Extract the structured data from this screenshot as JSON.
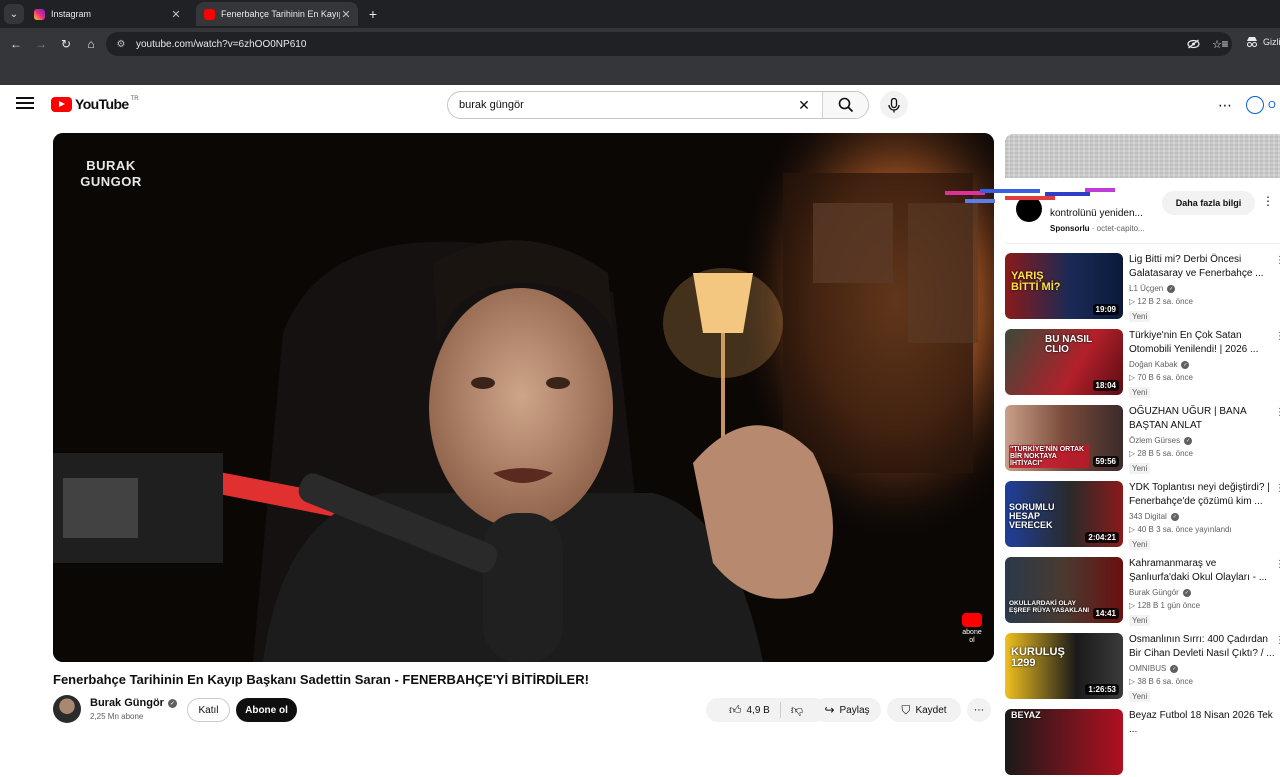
{
  "browser": {
    "tabs": [
      {
        "title": "Instagram",
        "active": false
      },
      {
        "title": "Fenerbahçe Tarihinin En Kayıp B",
        "active": true
      }
    ],
    "url": "youtube.com/watch?v=6zhOO0NP610",
    "profile_label": "Gizli"
  },
  "youtube": {
    "logo_text": "YouTube",
    "logo_country": "TR",
    "search_query": "burak güngör",
    "signin_label": "O"
  },
  "player": {
    "watermark": "BURAK GUNGOR",
    "subscribe_badge": "abone ol"
  },
  "video": {
    "title": "Fenerbahçe Tarihinin En Kayıp Başkanı Sadettin Saran - FENERBAHÇE'Yİ BİTİRDİLER!",
    "channel_name": "Burak Güngör",
    "subscribers": "2,25 Mn abone",
    "join_label": "Katıl",
    "subscribe_label": "Abone ol",
    "likes": "4,9 B",
    "share_label": "Paylaş",
    "save_label": "Kaydet"
  },
  "ad": {
    "text": "kontrolünü yeniden...",
    "sponsored": "Sponsorlu",
    "advertiser": "octet-capito...",
    "more_info": "Daha fazla bilgi"
  },
  "recommendations": [
    {
      "title": "Lig Bitti mi? Derbi Öncesi Galatasaray ve Fenerbahçe ...",
      "channel": "L1 Üçgen",
      "verified": true,
      "views": "12 B",
      "age": "2 sa. önce",
      "badge": "Yeni",
      "duration": "19:09",
      "thumb_text": "YARIŞ BİTTİ Mİ?"
    },
    {
      "title": "Türkiye'nin En Çok Satan Otomobili Yenilendi! | 2026 ...",
      "channel": "Doğan Kabak",
      "verified": true,
      "views": "70 B",
      "age": "6 sa. önce",
      "badge": "Yeni",
      "duration": "18:04",
      "thumb_text": "BU NASIL CLIO"
    },
    {
      "title": "OĞUZHAN UĞUR | BANA BAŞTAN ANLAT",
      "channel": "Özlem Gürses",
      "verified": true,
      "views": "28 B",
      "age": "5 sa. önce",
      "badge": "Yeni",
      "duration": "59:56",
      "thumb_text": "\"TÜRKİYE'NİN ORTAK BİR NOKTAYA İHTİYACI\""
    },
    {
      "title": "YDK Toplantısı neyi değiştirdi? | Fenerbahçe'de çözümü kim ...",
      "channel": "343 Digital",
      "verified": true,
      "views": "40 B",
      "age": "3 sa. önce yayınlandı",
      "badge": "Yeni",
      "duration": "2:04:21",
      "thumb_text": "SORUMLU HESAP VERECEK"
    },
    {
      "title": "Kahramanmaraş ve Şanlıurfa'daki Okul Olayları - ...",
      "channel": "Burak Güngör",
      "verified": true,
      "views": "128 B",
      "age": "1 gün önce",
      "badge": "Yeni",
      "duration": "14:41",
      "thumb_text": "OKULLARDAKİ OLAY EŞREF RÜYA YASAKLANI"
    },
    {
      "title": "Osmanlının Sırrı: 400 Çadırdan Bir Cihan Devleti Nasıl Çıktı? / ...",
      "channel": "OMNIBUS",
      "verified": true,
      "views": "38 B",
      "age": "6 sa. önce",
      "badge": "Yeni",
      "duration": "1:26:53",
      "thumb_text": "KURULUŞ 1299"
    },
    {
      "title": "Beyaz Futbol 18 Nisan 2026 Tek ...",
      "channel": "",
      "verified": false,
      "views": "",
      "age": "",
      "badge": "",
      "duration": "",
      "thumb_text": "BEYAZ"
    }
  ],
  "colors": {
    "brand_red": "#ff0000",
    "link_blue": "#065fd4",
    "chrome_dark": "#202124",
    "chrome_toolbar": "#35363a"
  }
}
